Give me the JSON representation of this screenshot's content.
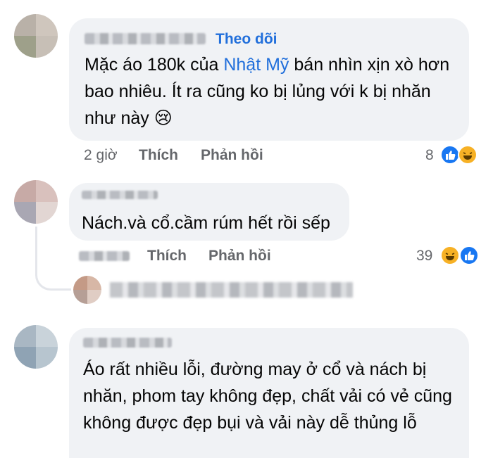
{
  "comments": [
    {
      "follow_label": "Theo dõi",
      "text_before": "Mặc áo 180k của ",
      "text_link": "Nhật Mỹ",
      "text_after": " bán nhìn xịn xò hơn bao nhiêu. Ít ra cũng ko bị lủng với k bị nhăn như này",
      "emoji": "😢",
      "time": "2 giờ",
      "like_label": "Thích",
      "reply_label": "Phản hồi",
      "reaction_count": "8",
      "reaction_icons": [
        "like-icon",
        "haha-icon"
      ]
    },
    {
      "text": "Nách.và cổ.cầm rúm hết rồi sếp",
      "like_label": "Thích",
      "reply_label": "Phản hồi",
      "reaction_count": "39",
      "reaction_icons": [
        "haha-icon",
        "like-icon"
      ]
    },
    {
      "text": "Áo rất nhiều lỗi, đường may ở cổ và nách bị nhăn, phom tay không đẹp, chất vải có vẻ cũng không được đẹp bụi và vải này dễ thủng lỗ"
    }
  ],
  "colors": {
    "bubble": "#f0f2f5",
    "link": "#216fdb",
    "meta": "#65676b",
    "like": "#1877f2",
    "haha": "#f7b125"
  }
}
